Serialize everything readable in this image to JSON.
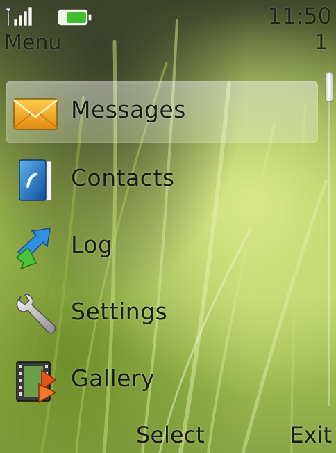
{
  "status": {
    "time": "11:50",
    "title": "Menu",
    "page": "1"
  },
  "menu": {
    "items": [
      {
        "label": "Messages",
        "icon": "envelope-icon",
        "selected": true
      },
      {
        "label": "Contacts",
        "icon": "contacts-book-icon",
        "selected": false
      },
      {
        "label": "Log",
        "icon": "call-log-arrows-icon",
        "selected": false
      },
      {
        "label": "Settings",
        "icon": "wrench-icon",
        "selected": false
      },
      {
        "label": "Gallery",
        "icon": "film-gallery-icon",
        "selected": false
      }
    ]
  },
  "softkeys": {
    "left": "Select",
    "right": "Exit"
  },
  "colors": {
    "text": "#1a1d12",
    "highlight": "#e6f0c8"
  }
}
